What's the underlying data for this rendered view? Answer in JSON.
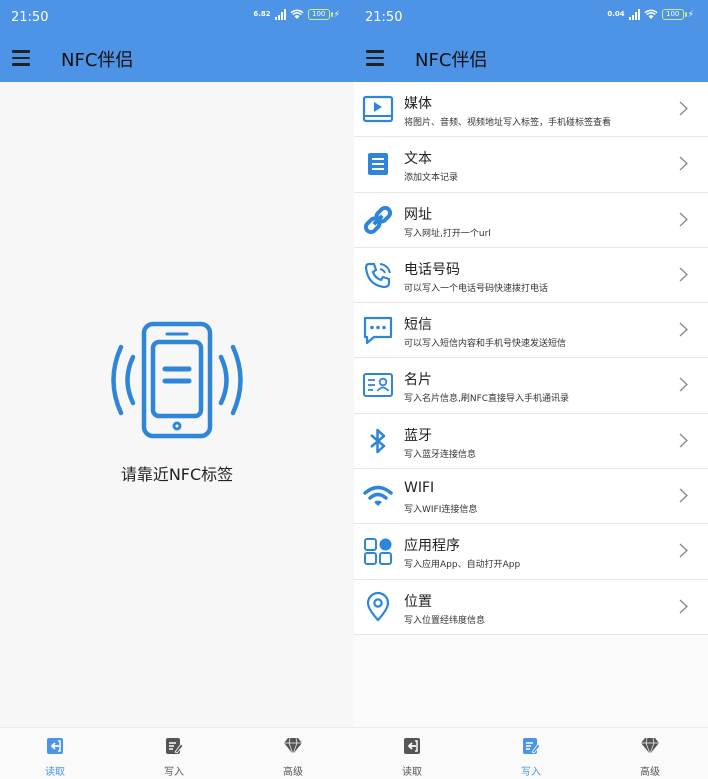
{
  "left": {
    "status": {
      "time": "21:50",
      "netspeed": "6.82",
      "battery": "100"
    },
    "appbar": {
      "title": "NFC伴侣"
    },
    "hint": "请靠近NFC标签",
    "tabs": [
      {
        "label": "读取",
        "icon": "read-icon",
        "active": true
      },
      {
        "label": "写入",
        "icon": "write-icon",
        "active": false
      },
      {
        "label": "高级",
        "icon": "diamond-icon",
        "active": false
      }
    ]
  },
  "right": {
    "status": {
      "time": "21:50",
      "netspeed": "0.04",
      "battery": "100"
    },
    "appbar": {
      "title": "NFC伴侣"
    },
    "items": [
      {
        "title": "媒体",
        "subtitle": "将图片、音频、视频地址写入标签，手机碰标签查看",
        "icon": "media-icon"
      },
      {
        "title": "文本",
        "subtitle": "添加文本记录",
        "icon": "text-icon"
      },
      {
        "title": "网址",
        "subtitle": "写入网址,打开一个url",
        "icon": "link-icon"
      },
      {
        "title": "电话号码",
        "subtitle": "可以写入一个电话号码快速拨打电话",
        "icon": "phone-icon"
      },
      {
        "title": "短信",
        "subtitle": "可以写入短信内容和手机号快速发送短信",
        "icon": "sms-icon"
      },
      {
        "title": "名片",
        "subtitle": "写入名片信息,刷NFC直接导入手机通讯录",
        "icon": "contact-card-icon"
      },
      {
        "title": "蓝牙",
        "subtitle": "写入蓝牙连接信息",
        "icon": "bluetooth-icon"
      },
      {
        "title": "WIFI",
        "subtitle": "写入WIFI连接信息",
        "icon": "wifi-icon"
      },
      {
        "title": "应用程序",
        "subtitle": "写入应用App、自动打开App",
        "icon": "apps-icon"
      },
      {
        "title": "位置",
        "subtitle": "写入位置经纬度信息",
        "icon": "location-icon"
      }
    ],
    "tabs": [
      {
        "label": "读取",
        "icon": "read-icon",
        "active": false
      },
      {
        "label": "写入",
        "icon": "write-icon",
        "active": true
      },
      {
        "label": "高级",
        "icon": "diamond-icon",
        "active": false
      }
    ]
  },
  "colors": {
    "accent": "#4d93e6",
    "icon_blue": "#2f86d8"
  }
}
